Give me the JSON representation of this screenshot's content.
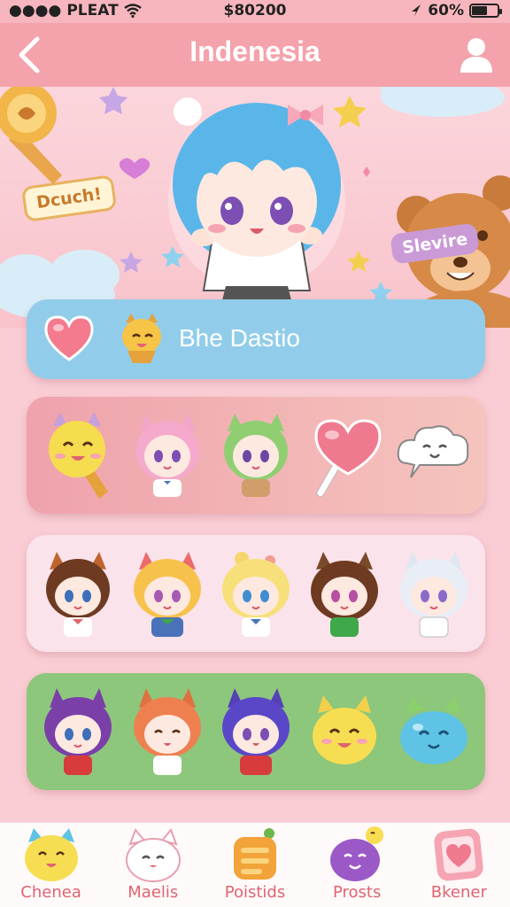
{
  "status_bar": {
    "carrier": "PLEAT",
    "time": "$80200",
    "battery": "60%",
    "battery_level": 0.6
  },
  "header": {
    "title": "Indenesia"
  },
  "banner": {
    "sticker_left": "Dcuch!",
    "sticker_right": "Slevire"
  },
  "hero": {
    "label": "Bhe Dastio"
  },
  "tabs": [
    {
      "label": "Chenea",
      "icon": "yellow-cat-icon"
    },
    {
      "label": "Maelis",
      "icon": "white-cat-icon"
    },
    {
      "label": "Poistids",
      "icon": "orange-box-icon"
    },
    {
      "label": "Prosts",
      "icon": "purple-blob-icon"
    },
    {
      "label": "Bkener",
      "icon": "pink-heart-icon"
    }
  ],
  "colors": {
    "nav": "#f4a2ab",
    "hero": "#91cdea",
    "row_green": "#8dc77b",
    "tab_label": "#e0646f"
  }
}
